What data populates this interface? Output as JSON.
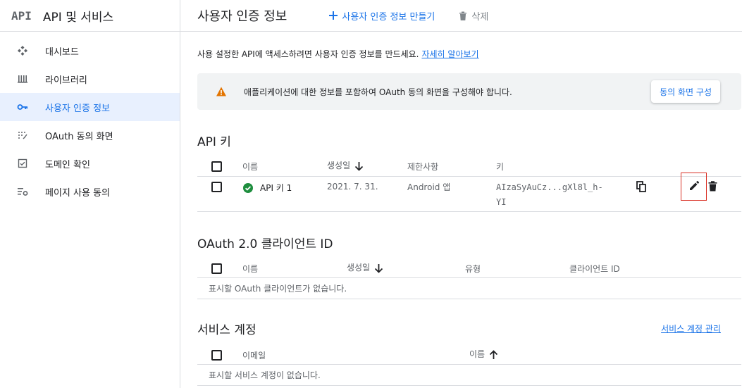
{
  "sidebar": {
    "logo": "API",
    "title": "API 및 서비스",
    "items": [
      {
        "label": "대시보드",
        "icon": "dashboard-icon"
      },
      {
        "label": "라이브러리",
        "icon": "library-icon"
      },
      {
        "label": "사용자 인증 정보",
        "icon": "key-icon",
        "active": true
      },
      {
        "label": "OAuth 동의 화면",
        "icon": "consent-icon"
      },
      {
        "label": "도메인 확인",
        "icon": "checkbox-icon"
      },
      {
        "label": "페이지 사용 동의",
        "icon": "settings-list-icon"
      }
    ]
  },
  "header": {
    "title": "사용자 인증 정보",
    "create_label": "사용자 인증 정보 만들기",
    "delete_label": "삭제"
  },
  "intro": {
    "text": "사용 설정한 API에 액세스하려면 사용자 인증 정보를 만드세요.",
    "link": "자세히 알아보기"
  },
  "banner": {
    "message": "애플리케이션에 대한 정보를 포함하여 OAuth 동의 화면을 구성해야 합니다.",
    "button": "동의 화면 구성"
  },
  "api_keys": {
    "title": "API 키",
    "columns": [
      "이름",
      "생성일",
      "제한사항",
      "키"
    ],
    "rows": [
      {
        "name": "API 키 1",
        "created": "2021. 7. 31.",
        "restriction": "Android 앱",
        "key_line1": "AIzaSyAuCz...gXl8l_h-",
        "key_line2": "YI"
      }
    ]
  },
  "oauth": {
    "title": "OAuth 2.0 클라이언트 ID",
    "columns": [
      "이름",
      "생성일",
      "유형",
      "클라이언트 ID"
    ],
    "empty": "표시할 OAuth 클라이언트가 없습니다."
  },
  "service_accounts": {
    "title": "서비스 계정",
    "manage_link": "서비스 계정 관리",
    "columns": [
      "이메일",
      "이름"
    ],
    "empty": "표시할 서비스 계정이 없습니다."
  },
  "colors": {
    "accent": "#1a73e8",
    "active_bg": "#e8f0fe",
    "success": "#1e8e3e",
    "warning": "#e37400",
    "highlight": "#d93025"
  }
}
